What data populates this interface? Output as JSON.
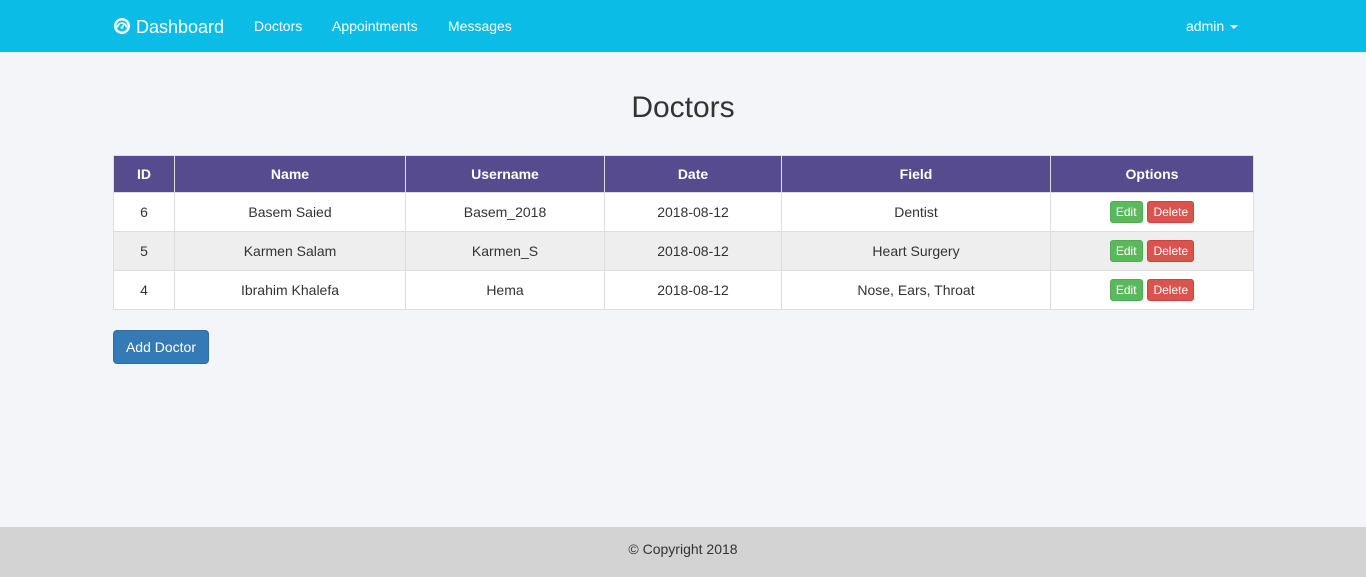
{
  "navbar": {
    "brand": "Dashboard",
    "brand_icon": "dashboard-gauge-icon",
    "links": [
      "Doctors",
      "Appointments",
      "Messages"
    ],
    "user": "admin",
    "background": "#0bbde6"
  },
  "page": {
    "title": "Doctors"
  },
  "table": {
    "headers": [
      "ID",
      "Name",
      "Username",
      "Date",
      "Field",
      "Options"
    ],
    "header_color": "#574b90",
    "rows": [
      {
        "id": "6",
        "name": "Basem Saied",
        "username": "Basem_2018",
        "date": "2018-08-12",
        "field": "Dentist"
      },
      {
        "id": "5",
        "name": "Karmen Salam",
        "username": "Karmen_S",
        "date": "2018-08-12",
        "field": "Heart Surgery"
      },
      {
        "id": "4",
        "name": "Ibrahim Khalefa",
        "username": "Hema",
        "date": "2018-08-12",
        "field": "Nose, Ears, Throat"
      }
    ],
    "edit_label": "Edit",
    "delete_label": "Delete"
  },
  "actions": {
    "add_label": "Add Doctor"
  },
  "footer": {
    "text": "© Copyright 2018"
  }
}
